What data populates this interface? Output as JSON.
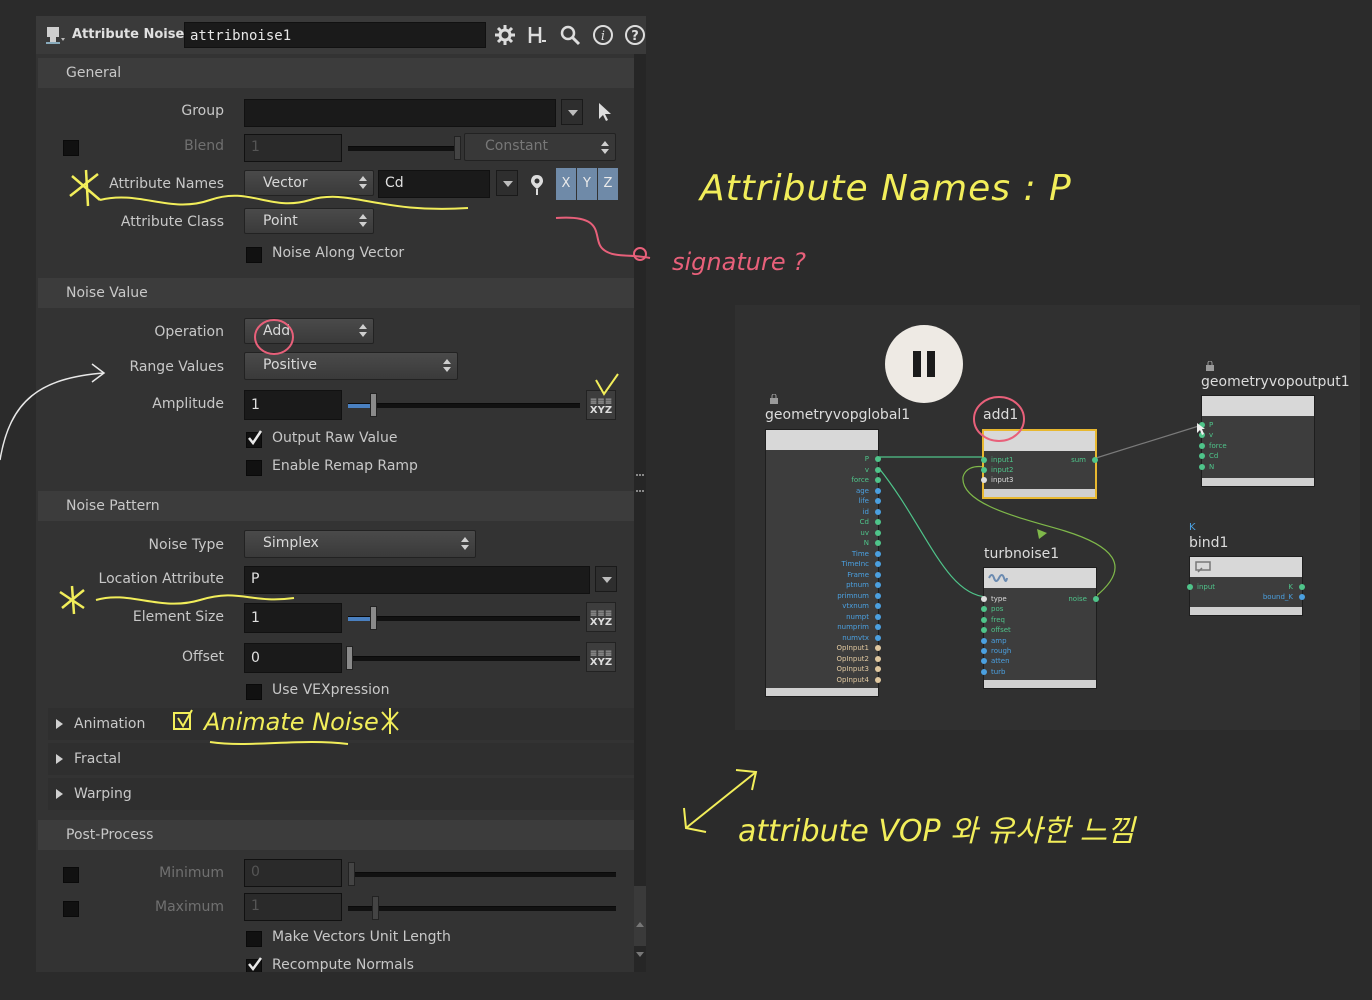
{
  "header": {
    "node_type": "Attribute Noise",
    "node_name": "attribnoise1"
  },
  "icons": [
    "node-icon",
    "gear-icon",
    "houdini-help-icon",
    "search-icon",
    "info-icon",
    "help-icon"
  ],
  "sections": {
    "general": {
      "title": "General",
      "group_label": "Group",
      "group_value": "",
      "blend_label": "Blend",
      "blend_value": "1",
      "blend_mode": "Constant",
      "attr_names_label": "Attribute Names",
      "attr_type": "Vector",
      "attr_names_value": "Cd",
      "components": [
        "X",
        "Y",
        "Z"
      ],
      "attr_class_label": "Attribute Class",
      "attr_class": "Point",
      "noise_along_vector": "Noise Along Vector"
    },
    "noise_value": {
      "title": "Noise Value",
      "operation_label": "Operation",
      "operation": "Add",
      "range_label": "Range Values",
      "range": "Positive",
      "amplitude_label": "Amplitude",
      "amplitude": "1",
      "output_raw": "Output Raw Value",
      "remap": "Enable Remap Ramp"
    },
    "noise_pattern": {
      "title": "Noise Pattern",
      "noise_type_label": "Noise Type",
      "noise_type": "Simplex",
      "location_label": "Location Attribute",
      "location": "P",
      "element_size_label": "Element Size",
      "element_size": "1",
      "offset_label": "Offset",
      "offset": "0",
      "vex": "Use VEXpression"
    },
    "folders": [
      "Animation",
      "Fractal",
      "Warping"
    ],
    "post_process": {
      "title": "Post-Process",
      "minimum_label": "Minimum",
      "minimum": "0",
      "maximum_label": "Maximum",
      "maximum": "1",
      "unit_length": "Make Vectors Unit Length",
      "recompute": "Recompute Normals"
    }
  },
  "xyz_label": "XYZ",
  "network": {
    "global_node": {
      "name": "geometryvopglobal1",
      "ports": [
        {
          "name": "P",
          "color": "#4fc48a"
        },
        {
          "name": "v",
          "color": "#4fc48a"
        },
        {
          "name": "force",
          "color": "#4fc48a"
        },
        {
          "name": "age",
          "color": "#4ba0e0"
        },
        {
          "name": "life",
          "color": "#4ba0e0"
        },
        {
          "name": "id",
          "color": "#4ba0e0"
        },
        {
          "name": "Cd",
          "color": "#4fc48a"
        },
        {
          "name": "uv",
          "color": "#4fc48a"
        },
        {
          "name": "N",
          "color": "#4fc48a"
        },
        {
          "name": "Time",
          "color": "#4ba0e0"
        },
        {
          "name": "TimeInc",
          "color": "#4ba0e0"
        },
        {
          "name": "Frame",
          "color": "#4ba0e0"
        },
        {
          "name": "ptnum",
          "color": "#4ba0e0"
        },
        {
          "name": "primnum",
          "color": "#4ba0e0"
        },
        {
          "name": "vtxnum",
          "color": "#4ba0e0"
        },
        {
          "name": "numpt",
          "color": "#4ba0e0"
        },
        {
          "name": "numprim",
          "color": "#4ba0e0"
        },
        {
          "name": "numvtx",
          "color": "#4ba0e0"
        },
        {
          "name": "OpInput1",
          "color": "#e0c8a0"
        },
        {
          "name": "OpInput2",
          "color": "#e0c8a0"
        },
        {
          "name": "OpInput3",
          "color": "#e0c8a0"
        },
        {
          "name": "OpInput4",
          "color": "#e0c8a0"
        }
      ]
    },
    "add_node": {
      "name": "add1",
      "inputs": [
        "input1",
        "input2",
        "input3"
      ],
      "output": "sum"
    },
    "turb_node": {
      "name": "turbnoise1",
      "inputs": [
        "type",
        "pos",
        "freq",
        "offset",
        "amp",
        "rough",
        "atten",
        "turb"
      ],
      "output": "noise"
    },
    "output_node": {
      "name": "geometryvopoutput1",
      "inputs": [
        "P",
        "v",
        "force",
        "Cd",
        "N"
      ]
    },
    "bind_node": {
      "name": "bind1",
      "badge": "K",
      "input": "input",
      "outputs": [
        "K",
        "bound_K"
      ]
    }
  },
  "annotations": {
    "attr_names_note": "Attribute Names : P",
    "signature_note": "signature ?",
    "animate_note": "Animate Noise",
    "vop_note": "attribute VOP 와 유사한 느낌"
  },
  "colors": {
    "accent_blue": "#4a80c0",
    "annotation_yellow": "#f2ee5a",
    "annotation_pink": "#e8607a",
    "add_node_border": "#e8b830"
  }
}
